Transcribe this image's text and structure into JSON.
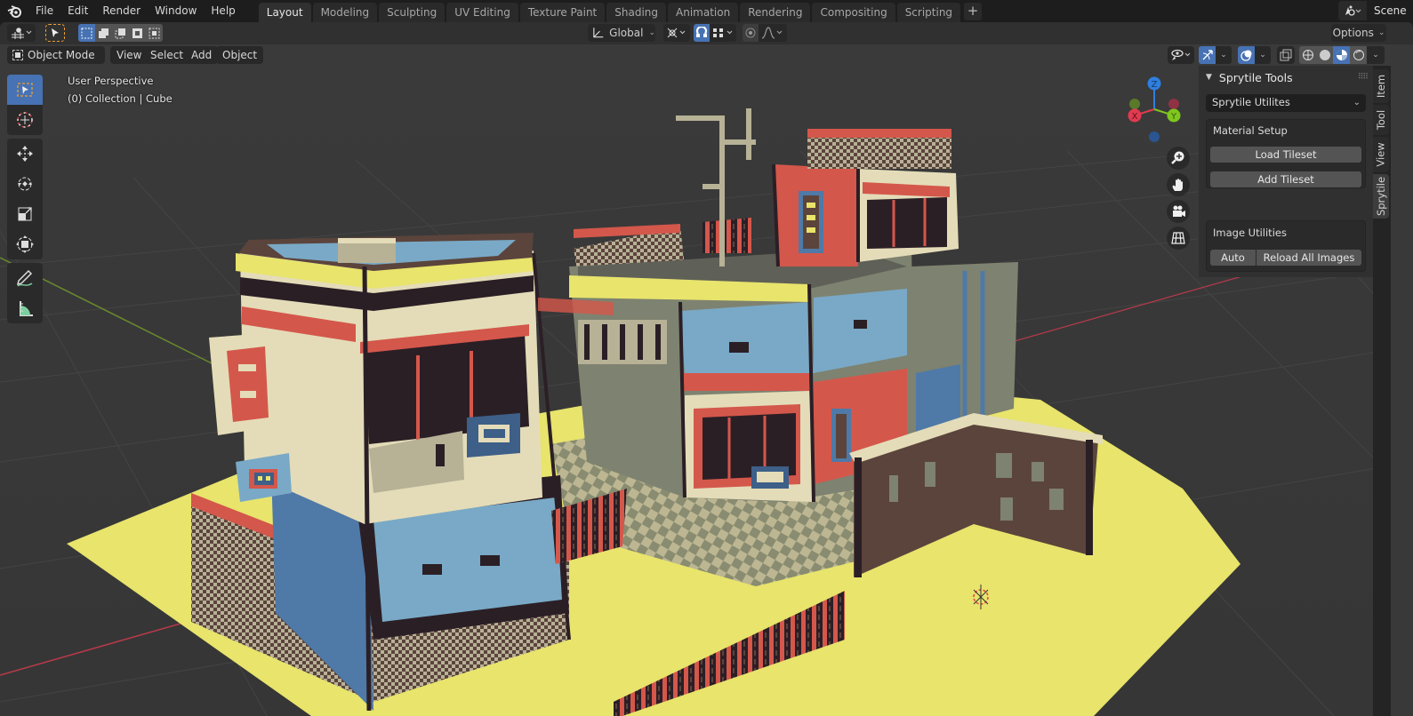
{
  "topbar": {
    "menus": [
      "File",
      "Edit",
      "Render",
      "Window",
      "Help"
    ],
    "workspaces": [
      "Layout",
      "Modeling",
      "Sculpting",
      "UV Editing",
      "Texture Paint",
      "Shading",
      "Animation",
      "Rendering",
      "Compositing",
      "Scripting"
    ],
    "active_workspace": "Layout",
    "add_workspace": "+",
    "scene_name": "Scene"
  },
  "tool_header": {
    "transform_orientation": "Global",
    "options_label": "Options"
  },
  "view_header": {
    "mode": "Object Mode",
    "menus": [
      "View",
      "Select",
      "Add",
      "Object"
    ]
  },
  "viewport": {
    "view_name": "User Perspective",
    "collection_info": "(0) Collection | Cube",
    "gizmo_axes": {
      "x": "X",
      "y": "Y",
      "z": "Z"
    },
    "colors": {
      "ground": "#e8e46c",
      "grid_bg": "#393939",
      "axis_x": "#b83a4a",
      "axis_y": "#6a8a2e",
      "brick_red": "#d4574b",
      "cream": "#e4dcb8",
      "dark": "#2b1f26",
      "blue": "#4f79a7",
      "light_blue": "#79a9c6",
      "olive_gray": "#7e8270",
      "brown": "#5b443c"
    }
  },
  "toolbar": {
    "tools": [
      "select-box",
      "cursor",
      "move",
      "rotate",
      "scale",
      "transform",
      "annotate",
      "measure"
    ],
    "active": "select-box"
  },
  "npanel": {
    "title": "Sprytile Tools",
    "dropdown_value": "Sprytile Utilites",
    "material_setup": {
      "title": "Material Setup",
      "load_tileset": "Load Tileset",
      "add_tileset": "Add Tileset"
    },
    "image_utilities": {
      "title": "Image Utilities",
      "auto": "Auto",
      "reload_all": "Reload All Images"
    },
    "tabs": [
      "Item",
      "Tool",
      "View",
      "Sprytile"
    ],
    "active_tab": "Sprytile"
  }
}
